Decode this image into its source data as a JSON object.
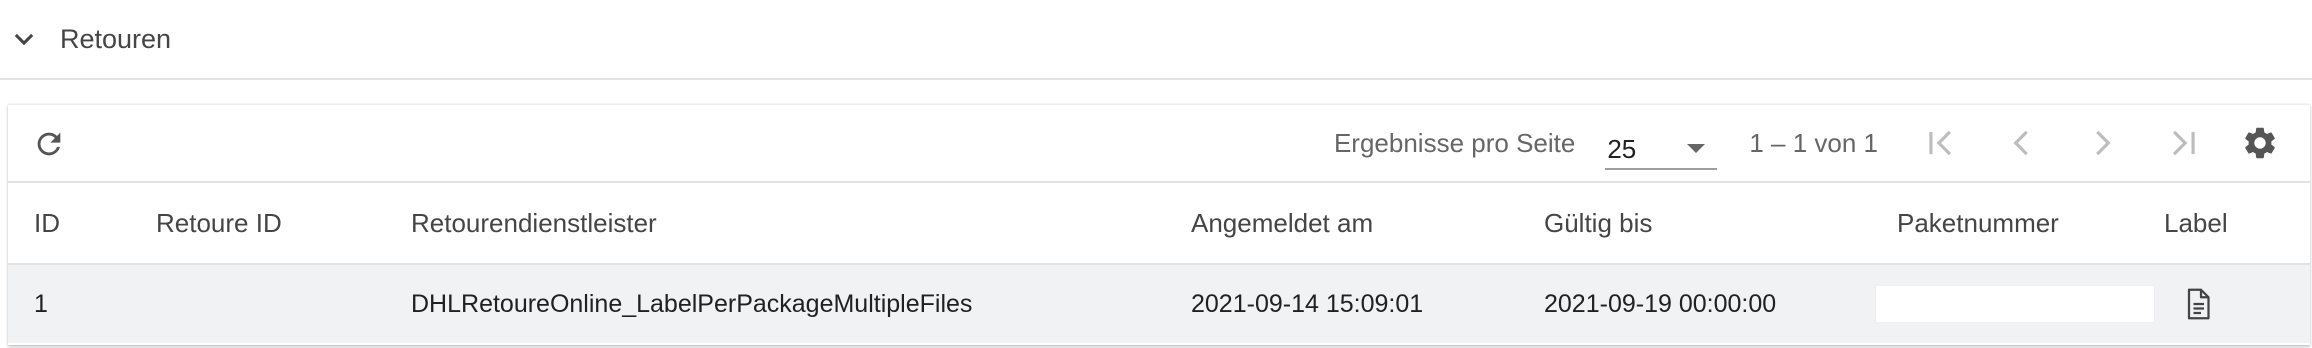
{
  "section": {
    "title": "Retouren",
    "icon": "chevron-down-icon"
  },
  "toolbar": {
    "refresh_icon": "refresh-icon",
    "page_size_label": "Ergebnisse pro Seite",
    "page_size_value": "25",
    "range_label": "1 – 1 von 1",
    "nav_icons": [
      "first-page-icon",
      "previous-page-icon",
      "next-page-icon",
      "last-page-icon"
    ],
    "settings_icon": "gear-icon"
  },
  "table": {
    "columns": [
      "ID",
      "Retoure ID",
      "Retourendienstleister",
      "Angemeldet am",
      "Gültig bis",
      "Paketnummer",
      "Label"
    ],
    "rows": [
      {
        "id": "1",
        "retoure_id": "",
        "dienstleister": "DHLRetoureOnline_LabelPerPackageMultipleFiles",
        "angemeldet": "2021-09-14 15:09:01",
        "gueltig": "2021-09-19 00:00:00",
        "paketnummer": "",
        "label_icon": "document-icon"
      }
    ]
  },
  "colors": {
    "text": "#212121",
    "muted": "#666666",
    "row_bg": "#f1f2f4",
    "divider": "#e3e3e3"
  }
}
